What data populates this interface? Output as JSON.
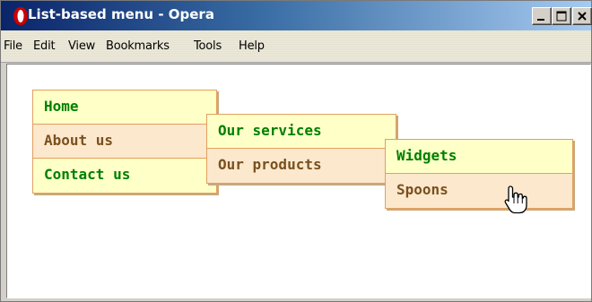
{
  "window": {
    "title": "List-based menu - Opera"
  },
  "menubar": {
    "items": [
      "File",
      "Edit",
      "View",
      "Bookmarks",
      "Tools",
      "Help"
    ]
  },
  "nav_menu": {
    "level1": [
      "Home",
      "About us",
      "Contact us"
    ],
    "level2": [
      "Our services",
      "Our products"
    ],
    "level3": [
      "Widgets",
      "Spoons"
    ]
  },
  "colors": {
    "item_green_bg": "#ffffc8",
    "item_green_text": "#008000",
    "item_brown_bg": "#fce8cc",
    "item_brown_text": "#7a5020",
    "menu_border": "#e0a060",
    "titlebar_start": "#0a246a",
    "titlebar_end": "#a6caf0"
  },
  "icons": {
    "app": "opera-logo-icon",
    "minimize": "minimize-icon",
    "maximize": "maximize-icon",
    "close": "close-icon",
    "pointer": "hand-pointer-icon"
  }
}
